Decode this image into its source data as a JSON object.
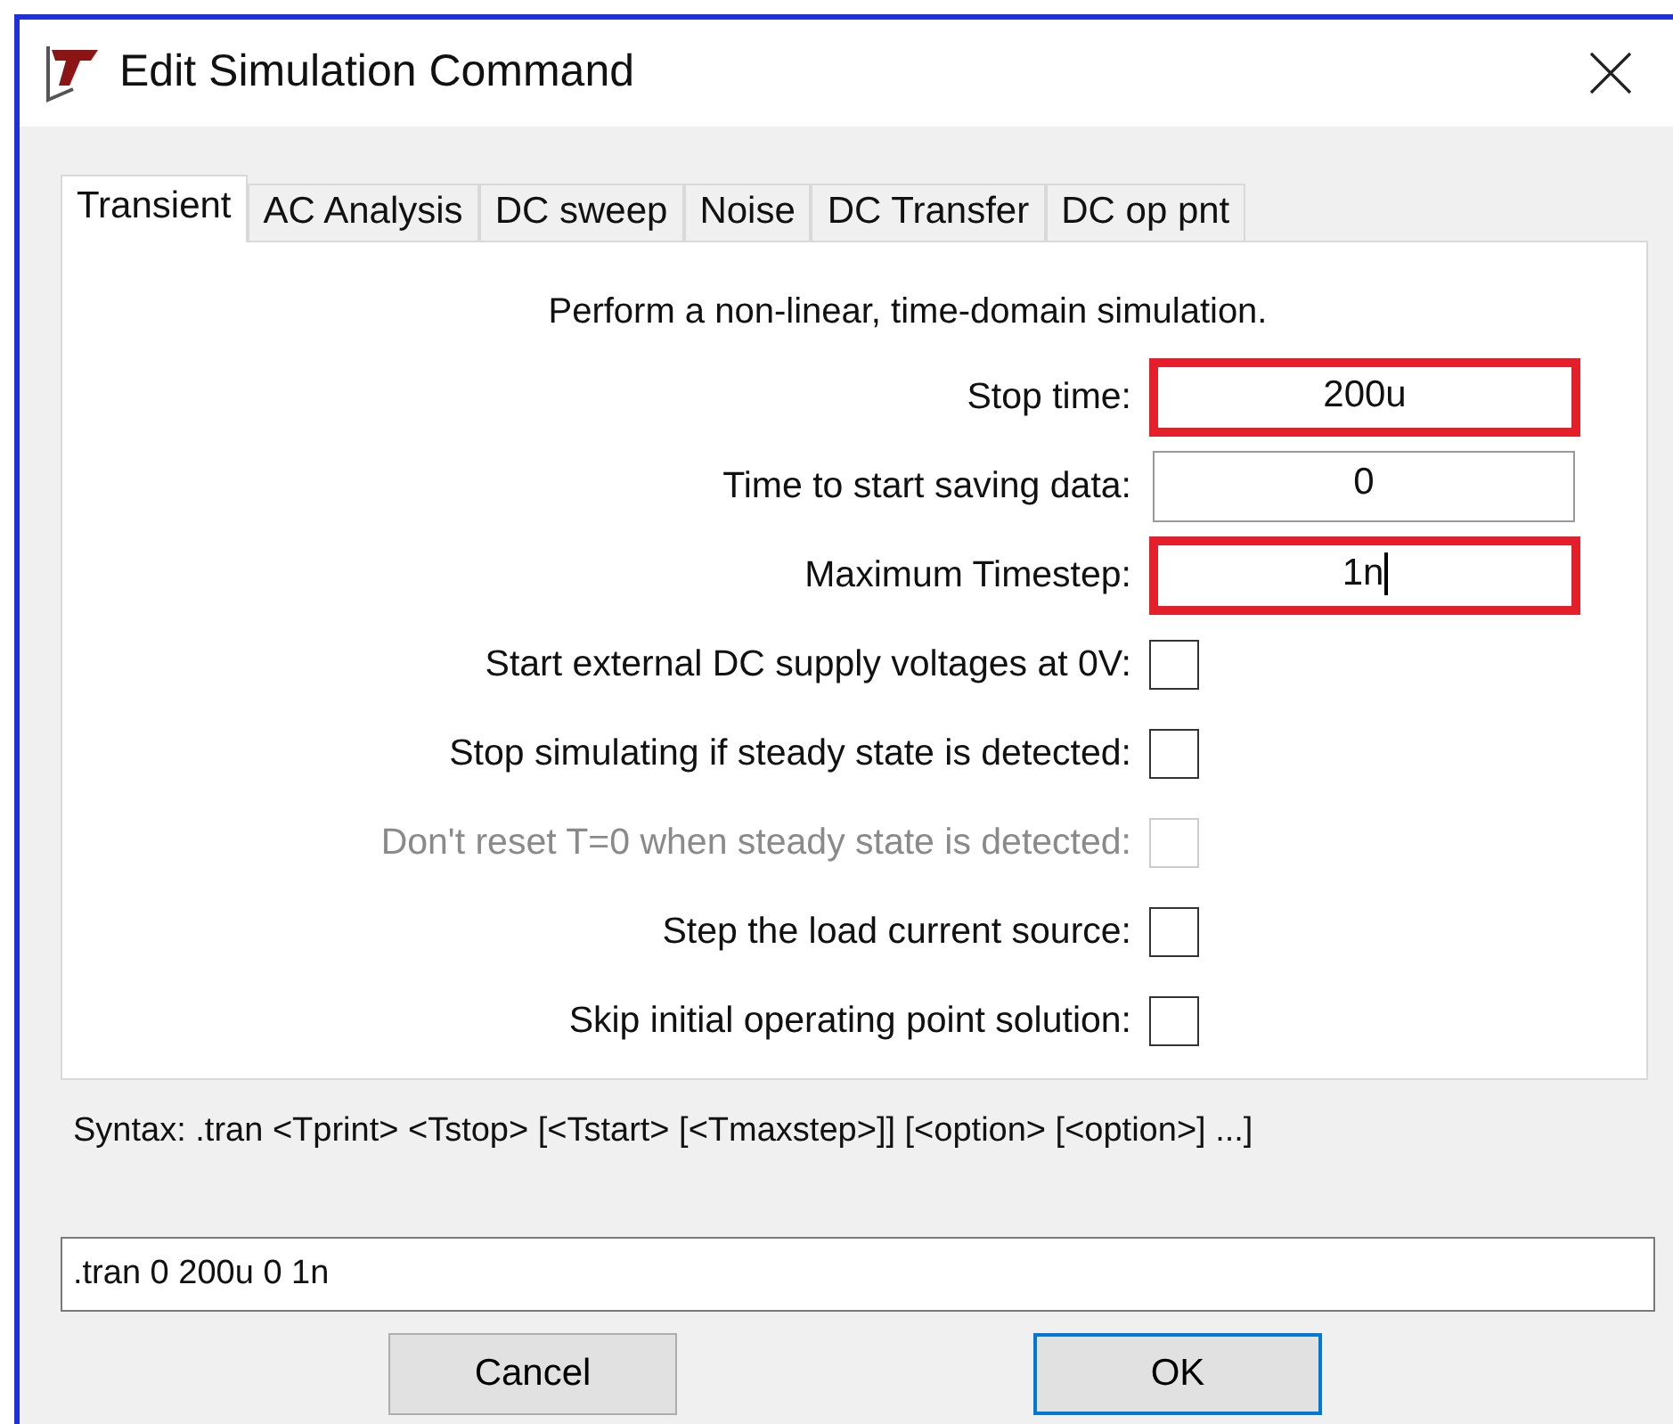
{
  "window": {
    "title": "Edit Simulation Command"
  },
  "tabs": [
    {
      "label": "Transient",
      "selected": true
    },
    {
      "label": "AC Analysis",
      "selected": false
    },
    {
      "label": "DC sweep",
      "selected": false
    },
    {
      "label": "Noise",
      "selected": false
    },
    {
      "label": "DC Transfer",
      "selected": false
    },
    {
      "label": "DC op pnt",
      "selected": false
    }
  ],
  "description": "Perform a non-linear, time-domain simulation.",
  "options": [
    {
      "kind": "field",
      "label": "Stop time:",
      "value": "200u",
      "highlighted": true,
      "focused": false
    },
    {
      "kind": "field",
      "label": "Time to start saving data:",
      "value": "0",
      "highlighted": false,
      "focused": false
    },
    {
      "kind": "field",
      "label": "Maximum Timestep:",
      "value": "1n",
      "highlighted": true,
      "focused": true
    },
    {
      "kind": "checkbox",
      "label": "Start external DC supply voltages at 0V:",
      "checked": false,
      "disabled": false
    },
    {
      "kind": "checkbox",
      "label": "Stop simulating if steady state is detected:",
      "checked": false,
      "disabled": false
    },
    {
      "kind": "checkbox",
      "label": "Don't reset T=0 when steady state is detected:",
      "checked": false,
      "disabled": true
    },
    {
      "kind": "checkbox",
      "label": "Step the load current source:",
      "checked": false,
      "disabled": false
    },
    {
      "kind": "checkbox",
      "label": "Skip initial operating point solution:",
      "checked": false,
      "disabled": false
    }
  ],
  "syntax": "Syntax:  .tran <Tprint> <Tstop> [<Tstart> [<Tmaxstep>]] [<option> [<option>] ...]",
  "command": ".tran 0 200u 0 1n",
  "buttons": [
    {
      "label": "Cancel",
      "default": false
    },
    {
      "label": "OK",
      "default": true
    }
  ]
}
